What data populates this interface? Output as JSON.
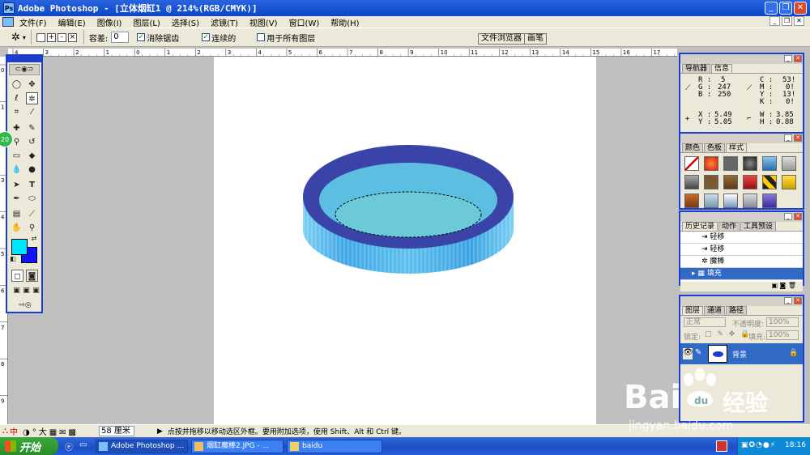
{
  "window": {
    "title": "Adobe Photoshop - [立体烟缸1 @ 214%(RGB/CMYK)]",
    "icon": "ps-icon"
  },
  "menu": [
    "文件(F)",
    "编辑(E)",
    "图像(I)",
    "图层(L)",
    "选择(S)",
    "滤镜(T)",
    "视图(V)",
    "窗口(W)",
    "帮助(H)"
  ],
  "options": {
    "tolerance_label": "容差:",
    "tolerance_value": "0",
    "anti_alias": "消除锯齿",
    "contiguous": "连续的",
    "all_layers": "用于所有图层",
    "file_browser": "文件浏览器",
    "brushes": "画笔"
  },
  "ruler_top_labels": [
    "4",
    "3",
    "2",
    "1",
    "0",
    "1",
    "2",
    "3",
    "4",
    "5",
    "6",
    "7",
    "8",
    "9",
    "10",
    "11",
    "12",
    "13",
    "14",
    "15",
    "16",
    "17"
  ],
  "ruler_left_labels": [
    "0",
    "1",
    "2",
    "3",
    "4",
    "5",
    "6",
    "7",
    "8",
    "9"
  ],
  "toolbox": {
    "badge": "20"
  },
  "info_panel": {
    "tabs": [
      "导航器",
      "信息"
    ],
    "r": "5",
    "g": "247",
    "b": "250",
    "c": "53!",
    "m": "0!",
    "y": "13!",
    "k": "0!",
    "x": "5.49",
    "yv": "5.05",
    "w": "3.85",
    "h": "0.88"
  },
  "styles_panel": {
    "tabs": [
      "颜色",
      "色板",
      "样式"
    ]
  },
  "history_panel": {
    "tabs": [
      "历史记录",
      "动作",
      "工具预设"
    ],
    "items": [
      "轻移",
      "轻移",
      "魔棒",
      "填充"
    ]
  },
  "layers_panel": {
    "tabs": [
      "图层",
      "通道",
      "路径"
    ],
    "blend_mode": "正常",
    "opacity_label": "不透明度:",
    "opacity_value": "100%",
    "lock_label": "锁定:",
    "fill_label": "填充:",
    "fill_value": "100%",
    "layer_name": "背景"
  },
  "status": {
    "zoom": "58 厘米",
    "message": "点按并拖移以移动选区外框。要用附加选项，使用 Shift、Alt 和 Ctrl 键。",
    "ime": "中"
  },
  "taskbar": {
    "start": "开始",
    "items": [
      "Adobe Photoshop ...",
      "烟缸魔棒2.JPG - ...",
      "baidu"
    ],
    "time": "18:16"
  },
  "watermark": {
    "brand": "Bai",
    "brand_tail": "经验",
    "url": "jingyan.baidu.com"
  },
  "colors": {
    "ring_top": "#3a43a8",
    "ring_side": "#4fb3e8",
    "inner": "#6ccad8",
    "foreground": "#00e5ff",
    "background": "#1212ff"
  }
}
